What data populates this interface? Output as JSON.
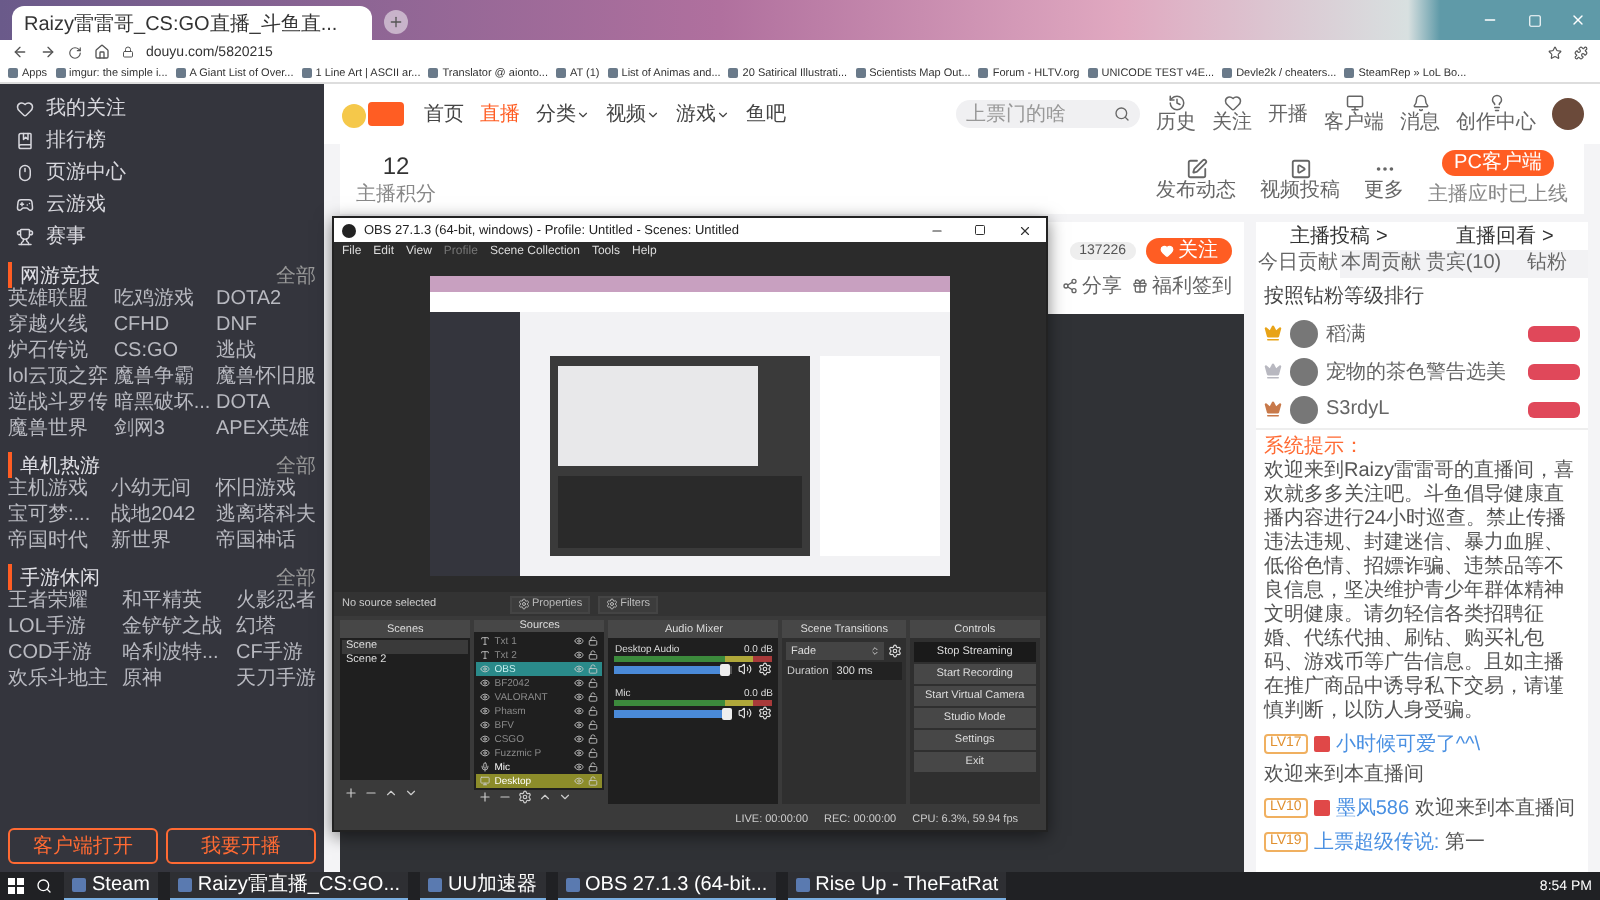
{
  "browser": {
    "tab_title": "Raizy雷雷哥_CS:GO直播_斗鱼直...",
    "url": "douyu.com/5820215",
    "bookmarks": [
      "Apps",
      "imgur: the simple i...",
      "A Giant List of Over...",
      "1 Line Art | ASCII ar...",
      "Translator @ aionto...",
      "AT (1)",
      "List of Animas and...",
      "20 Satirical Illustrati...",
      "Scientists Map Out...",
      "Forum - HLTV.org",
      "UNICODE TEST v4E...",
      "Devle2k / cheaters...",
      "SteamRep » LoL Bo..."
    ]
  },
  "sidebar": {
    "nav": [
      "我的关注",
      "排行榜",
      "页游中心",
      "云游戏",
      "赛事"
    ],
    "sections": [
      {
        "title": "网游竞技",
        "more": "全部",
        "items": [
          "英雄联盟",
          "吃鸡游戏",
          "DOTA2",
          "穿越火线",
          "CFHD",
          "DNF",
          "炉石传说",
          "CS:GO",
          "逃战",
          "lol云顶之弈",
          "魔兽争霸",
          "魔兽怀旧服",
          "逆战斗罗传",
          "暗黑破坏...",
          "DOTA",
          "魔兽世界",
          "剑网3",
          "APEX英雄"
        ]
      },
      {
        "title": "单机热游",
        "more": "全部",
        "items": [
          "主机游戏",
          "小幼无间",
          "怀旧游戏",
          "宝可梦:...",
          "战地2042",
          "逃离塔科夫",
          "帝国时代",
          "新世界",
          "帝国神话"
        ]
      },
      {
        "title": "手游休闲",
        "more": "全部",
        "items": [
          "王者荣耀",
          "和平精英",
          "火影忍者",
          "LOL手游",
          "金铲铲之战",
          "幻塔",
          "COD手游",
          "哈利波特...",
          "CF手游",
          "欢乐斗地主",
          "原神",
          "天刀手游"
        ]
      }
    ],
    "buttons": [
      "客户端打开",
      "我要开播"
    ]
  },
  "header": {
    "nav": [
      {
        "label": "首页",
        "selected": false,
        "dropdown": false
      },
      {
        "label": "直播",
        "selected": true,
        "dropdown": false
      },
      {
        "label": "分类",
        "selected": false,
        "dropdown": true
      },
      {
        "label": "视频",
        "selected": false,
        "dropdown": true
      },
      {
        "label": "游戏",
        "selected": false,
        "dropdown": true
      },
      {
        "label": "鱼吧",
        "selected": false,
        "dropdown": false
      }
    ],
    "search": {
      "placeholder": "上票门的啥"
    },
    "links": [
      "历史",
      "关注",
      "开播",
      "客户端",
      "消息",
      "创作中心"
    ]
  },
  "toolbar": {
    "score": "12",
    "score_label": "主播积分",
    "actions": [
      "发布动态",
      "视频投稿",
      "更多"
    ],
    "pc_button": "PC客户端",
    "pc_note": "主播应时已上线"
  },
  "streamer": {
    "followers": "137226",
    "follow": "关注",
    "share": "分享",
    "signin": "福利签到"
  },
  "obs": {
    "title": "OBS 27.1.3 (64-bit, windows) - Profile: Untitled - Scenes: Untitled",
    "menu": [
      {
        "label": "File",
        "disabled": false
      },
      {
        "label": "Edit",
        "disabled": false
      },
      {
        "label": "View",
        "disabled": false
      },
      {
        "label": "Profile",
        "disabled": true
      },
      {
        "label": "Scene Collection",
        "disabled": false
      },
      {
        "label": "Tools",
        "disabled": false
      },
      {
        "label": "Help",
        "disabled": false
      }
    ],
    "status_text": "No source selected",
    "properties": "Properties",
    "filters": "Filters",
    "scenes": {
      "title": "Scenes",
      "items": [
        {
          "name": "Scene",
          "selected": true
        },
        {
          "name": "Scene 2",
          "selected": false
        }
      ]
    },
    "sources": {
      "title": "Sources",
      "items": [
        {
          "name": "Txt 1",
          "kind": "text",
          "visible": false,
          "selected": false
        },
        {
          "name": "Txt 2",
          "kind": "text",
          "visible": false,
          "selected": false
        },
        {
          "name": "OBS",
          "kind": "capture",
          "visible": false,
          "selected": true
        },
        {
          "name": "BF2042",
          "kind": "capture",
          "visible": false,
          "selected": false
        },
        {
          "name": "VALORANT",
          "kind": "capture",
          "visible": false,
          "selected": false
        },
        {
          "name": "Phasm",
          "kind": "capture",
          "visible": false,
          "selected": false
        },
        {
          "name": "BFV",
          "kind": "capture",
          "visible": false,
          "selected": false
        },
        {
          "name": "CSGO",
          "kind": "capture",
          "visible": false,
          "selected": false
        },
        {
          "name": "Fuzzmic P",
          "kind": "capture",
          "visible": false,
          "selected": false
        },
        {
          "name": "Mic",
          "kind": "mic",
          "visible": true,
          "selected": false
        },
        {
          "name": "Desktop",
          "kind": "display",
          "visible": true,
          "selected": false,
          "color": "#8c8c2a"
        }
      ]
    },
    "mixer": {
      "title": "Audio Mixer",
      "channels": [
        {
          "name": "Desktop Audio",
          "reading": "0.0 dB",
          "level": 0.92
        },
        {
          "name": "Mic",
          "reading": "0.0 dB",
          "level": 0.94
        }
      ]
    },
    "transitions": {
      "title": "Scene Transitions",
      "value": "Fade",
      "duration_label": "Duration",
      "duration": "300 ms"
    },
    "controls": {
      "title": "Controls",
      "buttons": [
        {
          "label": "Stop Streaming",
          "active": true
        },
        {
          "label": "Start Recording",
          "active": false
        },
        {
          "label": "Start Virtual Camera",
          "active": false
        },
        {
          "label": "Studio Mode",
          "active": false
        },
        {
          "label": "Settings",
          "active": false
        },
        {
          "label": "Exit",
          "active": false
        }
      ]
    },
    "statusbar": {
      "live": "LIVE: 00:00:00",
      "rec": "REC: 00:00:00",
      "cpu": "CPU: 6.3%, 59.94 fps"
    }
  },
  "chat": {
    "links": [
      "主播投稿 >",
      "直播回看 >"
    ],
    "tabs": [
      {
        "label": "今日贡献",
        "selected": true
      },
      {
        "label": "本周贡献",
        "selected": false
      },
      {
        "label": "贵宾(10)",
        "selected": false
      },
      {
        "label": "钻粉",
        "selected": false
      }
    ],
    "rank_title": "按照钻粉等级排行",
    "ranking": [
      {
        "name": "稻满",
        "color": "#e8a317"
      },
      {
        "name": "宠物的茶色警告选美",
        "color": "#b8b8c0"
      },
      {
        "name": "S3rdyL",
        "color": "#c8794a"
      }
    ],
    "system": {
      "label": "系统提示：",
      "text": "欢迎来到Raizy雷雷哥的直播间，喜欢就多多关注吧。斗鱼倡导健康直播内容进行24小时巡查。禁止传播违法违规、封建迷信、暴力血腥、低俗色情、招嫖诈骗、违禁品等不良信息，坚决维护青少年群体精神文明健康。请勿轻信各类招聘征婚、代练代抽、刷钻、购买礼包码、游戏币等广告信息。且如主播在推广商品中诱导私下交易，请谨慎判断，以防人身受骗。"
    },
    "messages": [
      {
        "level": "LV17",
        "badge": true,
        "user": "小时候可爱了^^\\",
        "text": "欢迎来到本直播间"
      },
      {
        "level": "LV10",
        "badge": true,
        "user": "墨风586",
        "text": "欢迎来到本直播间"
      },
      {
        "level": "LV19",
        "badge": false,
        "user": "上票超级传说:",
        "text": "第一"
      }
    ]
  },
  "taskbar": {
    "apps": [
      "Steam",
      "Raizy雷直播_CS:GO...",
      "UU加速器",
      "OBS 27.1.3 (64-bit...",
      "Rise Up - TheFatRat"
    ],
    "time": "8:54 PM"
  }
}
